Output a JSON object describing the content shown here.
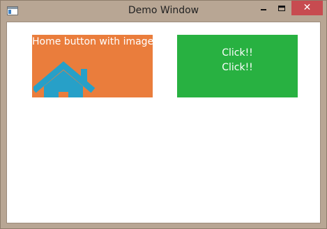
{
  "window": {
    "title": "Demo Window",
    "frame_color": "#b8a694",
    "close_color": "#c74b50"
  },
  "title_buttons": {
    "icons": [
      "minimize-icon",
      "maximize-icon",
      "close-icon"
    ],
    "close_glyph": "✕"
  },
  "home_button": {
    "label": "Home button with image",
    "icon": "home-icon",
    "background": "#ea7d3c",
    "icon_color": "#27a0c8"
  },
  "click_button": {
    "line1": "Click!!",
    "line2": "Click!!",
    "background": "#28b141"
  }
}
